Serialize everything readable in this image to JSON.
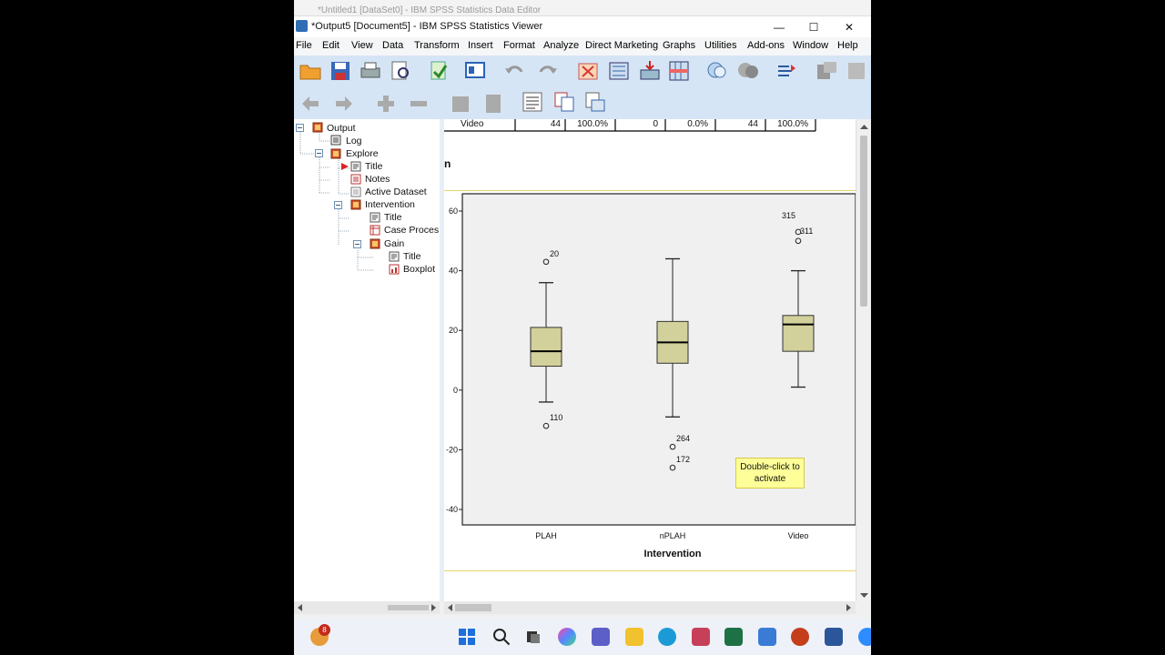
{
  "background_window": {
    "title": "*Untitled1 [DataSet0] - IBM SPSS Statistics Data Editor"
  },
  "window": {
    "title": "*Output5 [Document5] - IBM SPSS Statistics Viewer",
    "min": "—",
    "max": "☐",
    "close": "✕"
  },
  "menu": [
    "File",
    "Edit",
    "View",
    "Data",
    "Transform",
    "Insert",
    "Format",
    "Analyze",
    "Direct Marketing",
    "Graphs",
    "Utilities",
    "Add-ons",
    "Window",
    "Help"
  ],
  "tree": {
    "output": "Output",
    "log": "Log",
    "explore": "Explore",
    "title1": "Title",
    "notes": "Notes",
    "active_dataset": "Active Dataset",
    "intervention": "Intervention",
    "title2": "Title",
    "case_processing": "Case Proces",
    "gain": "Gain",
    "title3": "Title",
    "boxplot": "Boxplot"
  },
  "table_row": [
    "Video",
    "44",
    "100.0%",
    "0",
    "0.0%",
    "44",
    "100.0%"
  ],
  "section_heading_fragment": "n",
  "tooltip": {
    "line1": "Double-click to",
    "line2": "activate"
  },
  "chart_data": {
    "type": "box",
    "xlabel": "Intervention",
    "ylabel": "",
    "ylim": [
      -40,
      60
    ],
    "yticks": [
      60,
      40,
      20,
      0,
      -20,
      -40
    ],
    "categories": [
      "PLAH",
      "nPLAH",
      "Video"
    ],
    "boxes": [
      {
        "category": "PLAH",
        "whisker_low": -4,
        "q1": 8,
        "median": 13,
        "q3": 21,
        "whisker_high": 36,
        "outliers": [
          {
            "label": "20",
            "value": 43
          },
          {
            "label": "110",
            "value": -12
          }
        ]
      },
      {
        "category": "nPLAH",
        "whisker_low": -9,
        "q1": 9,
        "median": 16,
        "q3": 23,
        "whisker_high": 44,
        "outliers": [
          {
            "label": "264",
            "value": -19
          },
          {
            "label": "172",
            "value": -26
          }
        ]
      },
      {
        "category": "Video",
        "whisker_low": 1,
        "q1": 13,
        "median": 22,
        "q3": 25,
        "whisker_high": 40,
        "outliers": [
          {
            "label": "315",
            "value": 53
          },
          {
            "label": "311",
            "value": 50
          }
        ]
      }
    ],
    "box_color": "#d3d19b",
    "plot_background": "#f0f0f0"
  },
  "taskbar": {
    "badge": "8"
  }
}
